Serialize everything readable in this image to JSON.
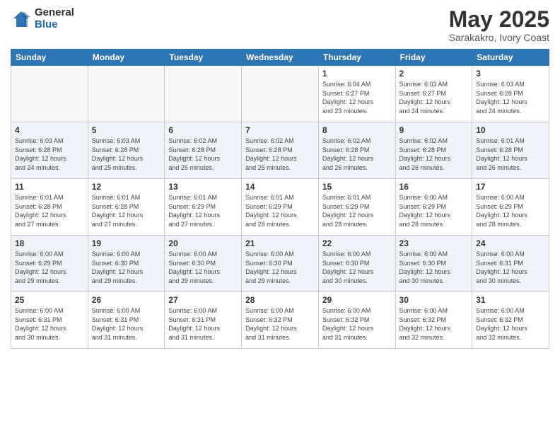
{
  "header": {
    "logo_general": "General",
    "logo_blue": "Blue",
    "month": "May 2025",
    "location": "Sarakakro, Ivory Coast"
  },
  "weekdays": [
    "Sunday",
    "Monday",
    "Tuesday",
    "Wednesday",
    "Thursday",
    "Friday",
    "Saturday"
  ],
  "weeks": [
    [
      {
        "day": "",
        "info": ""
      },
      {
        "day": "",
        "info": ""
      },
      {
        "day": "",
        "info": ""
      },
      {
        "day": "",
        "info": ""
      },
      {
        "day": "1",
        "info": "Sunrise: 6:04 AM\nSunset: 6:27 PM\nDaylight: 12 hours\nand 23 minutes."
      },
      {
        "day": "2",
        "info": "Sunrise: 6:03 AM\nSunset: 6:27 PM\nDaylight: 12 hours\nand 24 minutes."
      },
      {
        "day": "3",
        "info": "Sunrise: 6:03 AM\nSunset: 6:28 PM\nDaylight: 12 hours\nand 24 minutes."
      }
    ],
    [
      {
        "day": "4",
        "info": "Sunrise: 6:03 AM\nSunset: 6:28 PM\nDaylight: 12 hours\nand 24 minutes."
      },
      {
        "day": "5",
        "info": "Sunrise: 6:03 AM\nSunset: 6:28 PM\nDaylight: 12 hours\nand 25 minutes."
      },
      {
        "day": "6",
        "info": "Sunrise: 6:02 AM\nSunset: 6:28 PM\nDaylight: 12 hours\nand 25 minutes."
      },
      {
        "day": "7",
        "info": "Sunrise: 6:02 AM\nSunset: 6:28 PM\nDaylight: 12 hours\nand 25 minutes."
      },
      {
        "day": "8",
        "info": "Sunrise: 6:02 AM\nSunset: 6:28 PM\nDaylight: 12 hours\nand 26 minutes."
      },
      {
        "day": "9",
        "info": "Sunrise: 6:02 AM\nSunset: 6:28 PM\nDaylight: 12 hours\nand 26 minutes."
      },
      {
        "day": "10",
        "info": "Sunrise: 6:01 AM\nSunset: 6:28 PM\nDaylight: 12 hours\nand 26 minutes."
      }
    ],
    [
      {
        "day": "11",
        "info": "Sunrise: 6:01 AM\nSunset: 6:28 PM\nDaylight: 12 hours\nand 27 minutes."
      },
      {
        "day": "12",
        "info": "Sunrise: 6:01 AM\nSunset: 6:28 PM\nDaylight: 12 hours\nand 27 minutes."
      },
      {
        "day": "13",
        "info": "Sunrise: 6:01 AM\nSunset: 6:29 PM\nDaylight: 12 hours\nand 27 minutes."
      },
      {
        "day": "14",
        "info": "Sunrise: 6:01 AM\nSunset: 6:29 PM\nDaylight: 12 hours\nand 28 minutes."
      },
      {
        "day": "15",
        "info": "Sunrise: 6:01 AM\nSunset: 6:29 PM\nDaylight: 12 hours\nand 28 minutes."
      },
      {
        "day": "16",
        "info": "Sunrise: 6:00 AM\nSunset: 6:29 PM\nDaylight: 12 hours\nand 28 minutes."
      },
      {
        "day": "17",
        "info": "Sunrise: 6:00 AM\nSunset: 6:29 PM\nDaylight: 12 hours\nand 28 minutes."
      }
    ],
    [
      {
        "day": "18",
        "info": "Sunrise: 6:00 AM\nSunset: 6:29 PM\nDaylight: 12 hours\nand 29 minutes."
      },
      {
        "day": "19",
        "info": "Sunrise: 6:00 AM\nSunset: 6:30 PM\nDaylight: 12 hours\nand 29 minutes."
      },
      {
        "day": "20",
        "info": "Sunrise: 6:00 AM\nSunset: 6:30 PM\nDaylight: 12 hours\nand 29 minutes."
      },
      {
        "day": "21",
        "info": "Sunrise: 6:00 AM\nSunset: 6:30 PM\nDaylight: 12 hours\nand 29 minutes."
      },
      {
        "day": "22",
        "info": "Sunrise: 6:00 AM\nSunset: 6:30 PM\nDaylight: 12 hours\nand 30 minutes."
      },
      {
        "day": "23",
        "info": "Sunrise: 6:00 AM\nSunset: 6:30 PM\nDaylight: 12 hours\nand 30 minutes."
      },
      {
        "day": "24",
        "info": "Sunrise: 6:00 AM\nSunset: 6:31 PM\nDaylight: 12 hours\nand 30 minutes."
      }
    ],
    [
      {
        "day": "25",
        "info": "Sunrise: 6:00 AM\nSunset: 6:31 PM\nDaylight: 12 hours\nand 30 minutes."
      },
      {
        "day": "26",
        "info": "Sunrise: 6:00 AM\nSunset: 6:31 PM\nDaylight: 12 hours\nand 31 minutes."
      },
      {
        "day": "27",
        "info": "Sunrise: 6:00 AM\nSunset: 6:31 PM\nDaylight: 12 hours\nand 31 minutes."
      },
      {
        "day": "28",
        "info": "Sunrise: 6:00 AM\nSunset: 6:32 PM\nDaylight: 12 hours\nand 31 minutes."
      },
      {
        "day": "29",
        "info": "Sunrise: 6:00 AM\nSunset: 6:32 PM\nDaylight: 12 hours\nand 31 minutes."
      },
      {
        "day": "30",
        "info": "Sunrise: 6:00 AM\nSunset: 6:32 PM\nDaylight: 12 hours\nand 32 minutes."
      },
      {
        "day": "31",
        "info": "Sunrise: 6:00 AM\nSunset: 6:32 PM\nDaylight: 12 hours\nand 32 minutes."
      }
    ]
  ]
}
